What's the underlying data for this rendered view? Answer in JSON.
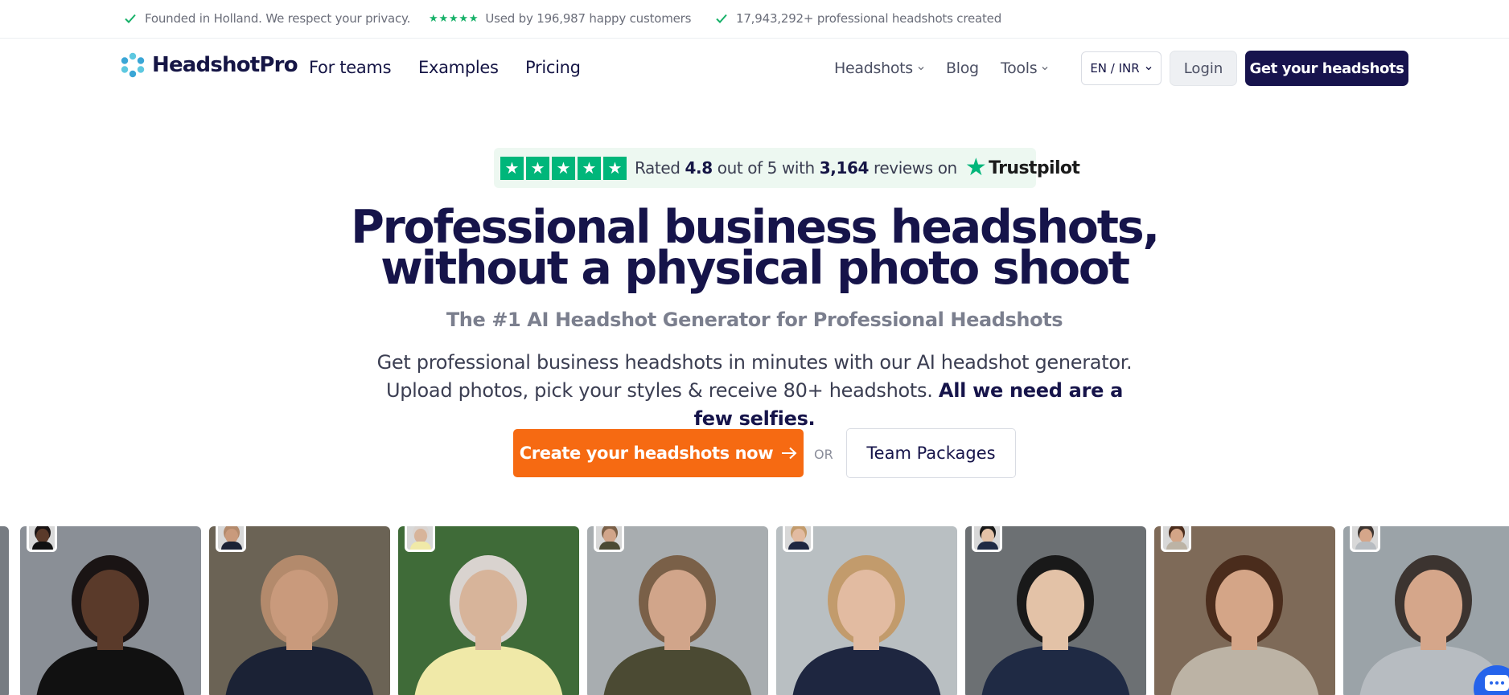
{
  "topbar": {
    "items": [
      {
        "icon": "check-icon",
        "text": "Founded in Holland. We respect your privacy."
      },
      {
        "icon": "five-stars-icon",
        "text": "Used by 196,987 happy customers"
      },
      {
        "icon": "check-icon",
        "text": "17,943,292+ professional headshots created"
      }
    ]
  },
  "nav": {
    "brand": "HeadshotPro",
    "links": [
      "For teams",
      "Examples",
      "Pricing"
    ],
    "secondary": [
      {
        "label": "Headshots",
        "dropdown": true
      },
      {
        "label": "Blog",
        "dropdown": false
      },
      {
        "label": "Tools",
        "dropdown": true
      }
    ],
    "language": "EN / INR",
    "login": "Login",
    "cta": "Get your headshots"
  },
  "trustpilot": {
    "rated": "Rated",
    "rating": "4.8",
    "out_of": "out of 5 with",
    "reviews": "3,164",
    "reviews_on": "reviews on",
    "brand": "Trustpilot",
    "stars": 5
  },
  "hero": {
    "title_line1": "Professional business headshots,",
    "title_line2": "without a physical photo shoot",
    "subtitle": "The #1 AI Headshot Generator for Professional Headshots",
    "desc_part1": "Get professional business headshots in minutes with our AI headshot generator. Upload photos, pick your styles & receive 80+ headshots.",
    "desc_bold": "All we need are a few selfies.",
    "cta": "Create your headshots now",
    "or": "OR",
    "secondary_cta": "Team Packages"
  },
  "gallery": {
    "cards": [
      {
        "name": "woman-dark-hair",
        "bg": "#8a8f96",
        "skin": "#5a3a2a",
        "hair": "#1a1414",
        "top": "#111111"
      },
      {
        "name": "man-bald",
        "bg": "#6b6355",
        "skin": "#c99a7c",
        "hair": "#b38a6c",
        "top": "#1b2235"
      },
      {
        "name": "woman-hijab",
        "bg": "#3f6b38",
        "skin": "#d7b49a",
        "hair": "#d9d3cf",
        "top": "#f0e9a8"
      },
      {
        "name": "man-glasses",
        "bg": "#a8adb0",
        "skin": "#d1a58a",
        "hair": "#7a6048",
        "top": "#4b4a33"
      },
      {
        "name": "woman-blonde",
        "bg": "#b9bfc2",
        "skin": "#e2bba1",
        "hair": "#c29b6c",
        "top": "#1e2640"
      },
      {
        "name": "man-asian",
        "bg": "#6c7073",
        "skin": "#e3c2a7",
        "hair": "#191919",
        "top": "#1f2a44"
      },
      {
        "name": "woman-long-hair",
        "bg": "#7e6a58",
        "skin": "#d4a587",
        "hair": "#4a2c1c",
        "top": "#bcb3a5"
      },
      {
        "name": "man-smiling",
        "bg": "#9ba3a8",
        "skin": "#d5a68a",
        "hair": "#3c3430",
        "top": "#b7bcc1"
      }
    ]
  },
  "colors": {
    "navy": "#17134d",
    "orange": "#f66a12",
    "green": "#00b67a",
    "chat": "#2563eb"
  }
}
